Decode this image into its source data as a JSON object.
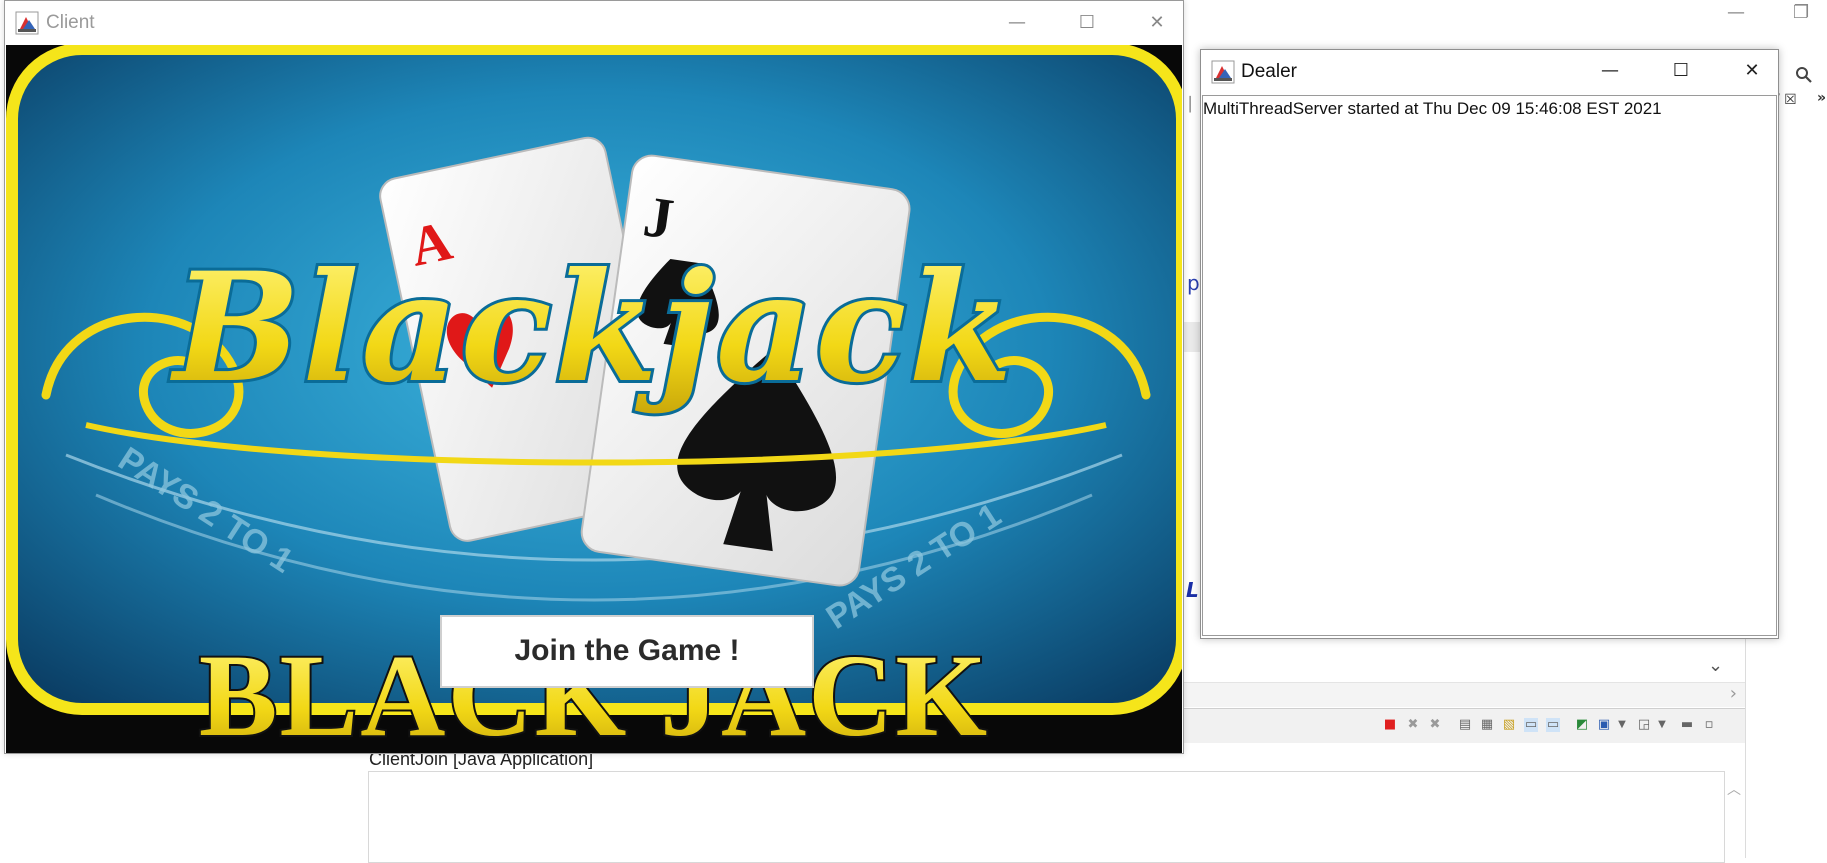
{
  "client_window": {
    "title": "Client",
    "controls": {
      "minimize": "—",
      "maximize": "☐",
      "close": "✕"
    },
    "image": {
      "script_title": "Blackjack",
      "banner": "BLACK JACK",
      "table_text_left": "PAYS 2 TO 1",
      "table_text_right": "PAYS 2 TO 1",
      "card_ace": "A",
      "card_jack": "J"
    },
    "join_button_label": "Join the Game !"
  },
  "dealer_window": {
    "title": "Dealer",
    "controls": {
      "minimize": "—",
      "maximize": "☐",
      "close": "✕"
    },
    "log_text": "MultiThreadServer started at Thu Dec 09 15:46:08 EST 2021"
  },
  "ide_background": {
    "console_title": "ClientJoin [Java Application]",
    "editor_fragment_1": "p",
    "editor_fragment_2": "L",
    "editor_fragment_3": "│",
    "tab_fragment": "/ ☒",
    "tab_chevron": "»",
    "window_controls": {
      "minimize": "—",
      "restore": "❐"
    }
  },
  "colors": {
    "felt_blue": "#1f7fb3",
    "gold": "#f2d816",
    "frame_yellow": "#f5e51a",
    "button_text": "#2b2b2b"
  }
}
